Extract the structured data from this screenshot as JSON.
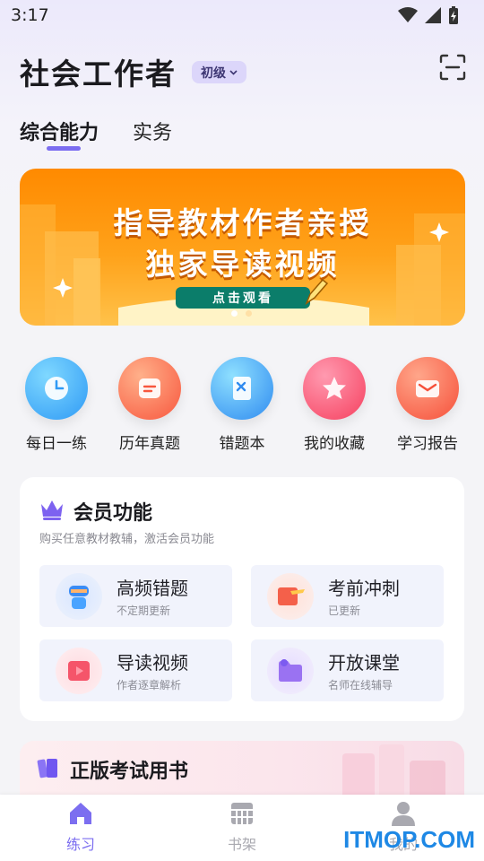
{
  "status_bar": {
    "time": "3:17"
  },
  "header": {
    "title": "社会工作者",
    "level": "初级"
  },
  "tabs": [
    {
      "label": "综合能力"
    },
    {
      "label": "实务"
    }
  ],
  "banner": {
    "line1": "指导教材作者亲授",
    "line2": "独家导读视频",
    "button": "点击观看"
  },
  "quick_actions": [
    {
      "label": "每日一练",
      "icon": "clock-icon"
    },
    {
      "label": "历年真题",
      "icon": "exam-paper-icon"
    },
    {
      "label": "错题本",
      "icon": "wrong-book-icon"
    },
    {
      "label": "我的收藏",
      "icon": "star-icon"
    },
    {
      "label": "学习报告",
      "icon": "mail-report-icon"
    }
  ],
  "member": {
    "title": "会员功能",
    "subtitle": "购买任意教材教辅，激活会员功能",
    "features": [
      {
        "title": "高频错题",
        "sub": "不定期更新"
      },
      {
        "title": "考前冲刺",
        "sub": "已更新"
      },
      {
        "title": "导读视频",
        "sub": "作者逐章解析"
      },
      {
        "title": "开放课堂",
        "sub": "名师在线辅导"
      }
    ]
  },
  "promo": {
    "title": "正版考试用书"
  },
  "nav": [
    {
      "label": "练习"
    },
    {
      "label": "书架"
    },
    {
      "label": "我的"
    }
  ],
  "watermark": "ITMOP.COM",
  "colors": {
    "accent": "#7c6ef0",
    "banner": "#ff8a00",
    "nav_active": "#7c6ef0",
    "watermark": "#1e88e5"
  }
}
